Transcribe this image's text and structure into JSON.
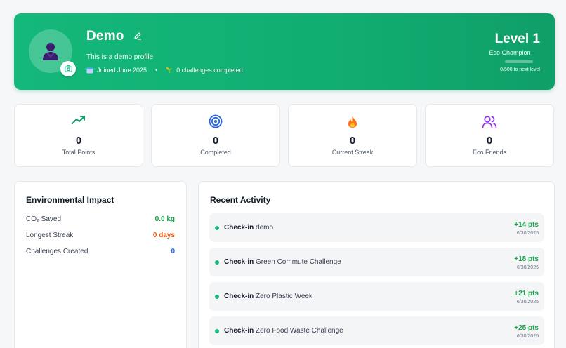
{
  "profile": {
    "name": "Demo",
    "bio": "This is a demo profile",
    "joined": "Joined June 2025",
    "challenges": "0 challenges completed"
  },
  "level": {
    "title": "Level 1",
    "rank": "Eco Champion",
    "next": "0/500 to next level",
    "progress": 0
  },
  "stats": [
    {
      "value": "0",
      "label": "Total Points",
      "icon": "trending-up-icon"
    },
    {
      "value": "0",
      "label": "Completed",
      "icon": "target-icon"
    },
    {
      "value": "0",
      "label": "Current Streak",
      "icon": "fire-icon"
    },
    {
      "value": "0",
      "label": "Eco Friends",
      "icon": "users-icon"
    }
  ],
  "impact": {
    "title": "Environmental Impact",
    "rows": [
      {
        "label": "CO₂ Saved",
        "value": "0.0 kg",
        "color": "#16a34a"
      },
      {
        "label": "Longest Streak",
        "value": "0 days",
        "color": "#ea580c"
      },
      {
        "label": "Challenges Created",
        "value": "0",
        "color": "#2563eb"
      }
    ]
  },
  "activity": {
    "title": "Recent Activity",
    "items": [
      {
        "kind": "Check-in",
        "name": "demo",
        "points": "+14 pts",
        "date": "6/30/2025"
      },
      {
        "kind": "Check-in",
        "name": "Green Commute Challenge",
        "points": "+18 pts",
        "date": "6/30/2025"
      },
      {
        "kind": "Check-in",
        "name": "Zero Plastic Week",
        "points": "+21 pts",
        "date": "6/30/2025"
      },
      {
        "kind": "Check-in",
        "name": "Zero Food Waste Challenge",
        "points": "+25 pts",
        "date": "6/30/2025"
      }
    ]
  },
  "colors": {
    "brand": "#14b87a",
    "accent_green": "#16a34a"
  }
}
